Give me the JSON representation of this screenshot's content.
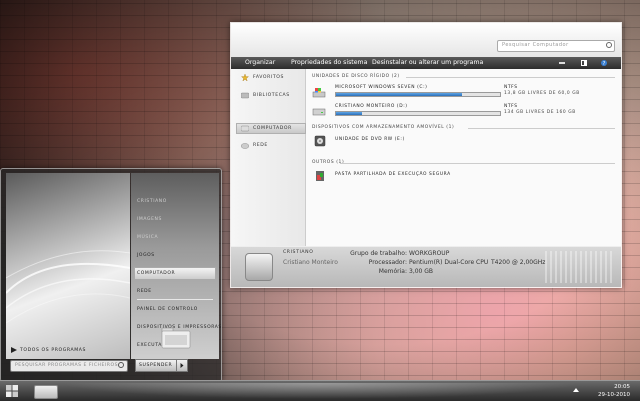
{
  "explorer": {
    "search_placeholder": "Pesquisar Computador",
    "toolbar": {
      "organize": "Organizar",
      "system_properties": "Propriedades do sistema",
      "uninstall": "Desinstalar ou alterar um programa"
    },
    "nav": {
      "items": [
        {
          "label": "Favoritos",
          "icon": "star-icon"
        },
        {
          "label": "Bibliotecas",
          "icon": "library-icon"
        },
        {
          "label": "Computador",
          "icon": "computer-icon",
          "selected": true
        },
        {
          "label": "Rede",
          "icon": "network-icon"
        }
      ]
    },
    "groups": {
      "hard_disks": "Unidades de Disco Rígido (2)",
      "removable": "Dispositivos com Armazenamento Amovível (1)",
      "other": "Outros (1)"
    },
    "drives": [
      {
        "name": "Microsoft Windows Seven (C:)",
        "fs": "NTFS",
        "free": "13,8 GB livres de 60,0 GB",
        "used_fraction": 0.77
      },
      {
        "name": "Cristiano Monteiro (D:)",
        "fs": "NTFS",
        "free": "134 GB livres de 160 GB",
        "used_fraction": 0.16
      }
    ],
    "removable_device": "Unidade de DVD RW (E:)",
    "other_item": "Pasta Partilhada de Execução Segura",
    "details": {
      "computer_name": "Cristiano",
      "user": "Cristiano Monteiro",
      "workgroup_label": "Grupo de trabalho:",
      "workgroup_value": "WORKGROUP",
      "processor_label": "Processador:",
      "processor_value": "Pentium(R) Dual-Core CPU",
      "processor_model": "T4200 @ 2,00GHz",
      "memory_label": "Memória:",
      "memory_value": "3,00 GB"
    }
  },
  "startmenu": {
    "all_programs": "Todos os Programas",
    "search_placeholder": "Pesquisar programas e ficheiros",
    "items": [
      {
        "label": "Cristiano",
        "dim": true
      },
      {
        "label": "Imagens",
        "dim": true
      },
      {
        "label": "Música",
        "dim": true
      },
      {
        "label": "Jogos",
        "dim": false
      },
      {
        "label": "Computador",
        "dim": false,
        "selected": true
      },
      {
        "label": "Rede",
        "dim": false
      },
      {
        "label": "Painel de Controlo",
        "dim": false
      },
      {
        "label": "Dispositivos e Impressoras",
        "dim": false
      },
      {
        "label": "Executar...",
        "dim": false
      }
    ],
    "shutdown": "Suspender"
  },
  "taskbar": {
    "time": "20:05",
    "date": "29-10-2010"
  },
  "colors": {
    "toolbar_dark": "#2c2c2c",
    "drive_bar": "#2c6fb8"
  }
}
